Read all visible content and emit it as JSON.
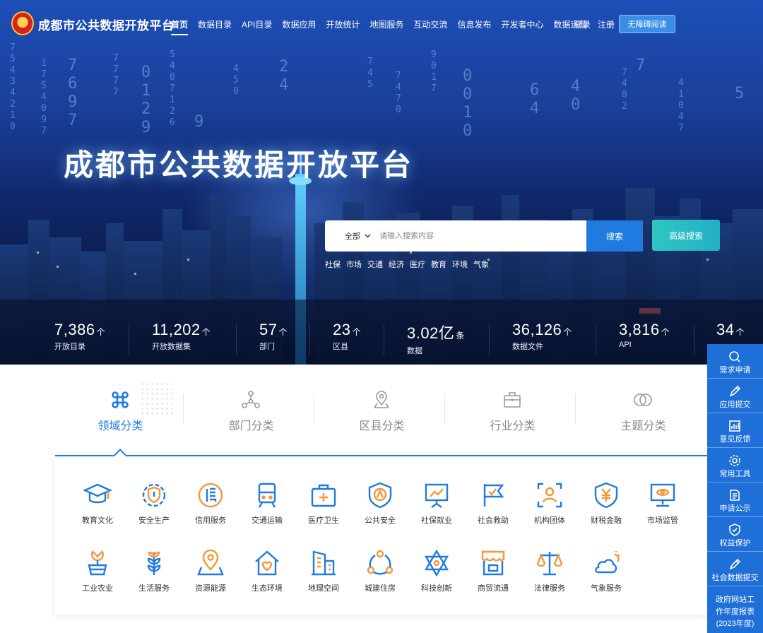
{
  "site": {
    "title": "成都市公共数据开放平台",
    "nav": [
      {
        "label": "首页",
        "active": true
      },
      {
        "label": "数据目录"
      },
      {
        "label": "API目录"
      },
      {
        "label": "数据应用"
      },
      {
        "label": "开放统计"
      },
      {
        "label": "地图服务"
      },
      {
        "label": "互动交流"
      },
      {
        "label": "信息发布"
      },
      {
        "label": "开发者中心"
      },
      {
        "label": "数据运营"
      }
    ],
    "login": "登录",
    "register": "注册",
    "accessibility": "无障碍阅读"
  },
  "hero": {
    "title": "成都市公共数据开放平台",
    "search": {
      "scope": "全部",
      "placeholder": "请输入搜索内容",
      "search_button": "搜索",
      "advanced_button": "高级搜索"
    },
    "hot_tags": [
      "社保",
      "市场",
      "交通",
      "经济",
      "医疗",
      "教育",
      "环境",
      "气象"
    ]
  },
  "stats": [
    {
      "value": "7,386",
      "unit": "个",
      "label": "开放目录"
    },
    {
      "value": "11,202",
      "unit": "个",
      "label": "开放数据集"
    },
    {
      "value": "57",
      "unit": "个",
      "label": "部门"
    },
    {
      "value": "23",
      "unit": "个",
      "label": "区县"
    },
    {
      "value": "3.02亿",
      "unit": "条",
      "label": "数据"
    },
    {
      "value": "36,126",
      "unit": "个",
      "label": "数据文件"
    },
    {
      "value": "3,816",
      "unit": "个",
      "label": "API"
    },
    {
      "value": "34",
      "unit": "个",
      "label": ""
    }
  ],
  "tabs": [
    {
      "label": "领域分类",
      "icon": "command-icon",
      "active": true
    },
    {
      "label": "部门分类",
      "icon": "org-tree-icon"
    },
    {
      "label": "区县分类",
      "icon": "map-pin-icon"
    },
    {
      "label": "行业分类",
      "icon": "briefcase-icon"
    },
    {
      "label": "主题分类",
      "icon": "circles-icon"
    }
  ],
  "categories": [
    {
      "label": "教育文化",
      "icon": "mortarboard-icon"
    },
    {
      "label": "安全生产",
      "icon": "shield-gear-icon"
    },
    {
      "label": "信用服务",
      "icon": "credit-icon"
    },
    {
      "label": "交通运输",
      "icon": "train-icon"
    },
    {
      "label": "医疗卫生",
      "icon": "medical-kit-icon"
    },
    {
      "label": "公共安全",
      "icon": "police-badge-icon"
    },
    {
      "label": "社保就业",
      "icon": "presentation-icon"
    },
    {
      "label": "社会救助",
      "icon": "flag-icon"
    },
    {
      "label": "机构团体",
      "icon": "person-frame-icon"
    },
    {
      "label": "财税金融",
      "icon": "yuan-shield-icon"
    },
    {
      "label": "市场监管",
      "icon": "monitor-eye-icon"
    },
    {
      "label": "工业农业",
      "icon": "flower-pot-icon"
    },
    {
      "label": "生活服务",
      "icon": "wheat-icon"
    },
    {
      "label": "资源能源",
      "icon": "location-icon"
    },
    {
      "label": "生态环境",
      "icon": "house-heart-icon"
    },
    {
      "label": "地理空间",
      "icon": "building-icon"
    },
    {
      "label": "城建住房",
      "icon": "network-icon"
    },
    {
      "label": "科技创新",
      "icon": "star-of-david-icon"
    },
    {
      "label": "商贸流通",
      "icon": "store-icon"
    },
    {
      "label": "法律服务",
      "icon": "scales-icon"
    },
    {
      "label": "气象服务",
      "icon": "cloud-sun-icon"
    }
  ],
  "sidebar": {
    "items": [
      {
        "label": "需求申请",
        "icon": "search-icon"
      },
      {
        "label": "应用提交",
        "icon": "pen-icon"
      },
      {
        "label": "意见反馈",
        "icon": "chart-icon"
      },
      {
        "label": "常用工具",
        "icon": "gear-icon"
      },
      {
        "label": "申请公示",
        "icon": "document-icon"
      },
      {
        "label": "权益保护",
        "icon": "shield-check-icon"
      },
      {
        "label": "社会数据提交",
        "icon": "pen-icon"
      }
    ],
    "report_lines": [
      "政府网站工",
      "作年度报表",
      "(2023年度)"
    ]
  },
  "colors": {
    "primary": "#1f7be0",
    "sidebar": "#1f6fd8",
    "accent_orange": "#f5963a",
    "teal": "#2fc6c0"
  }
}
